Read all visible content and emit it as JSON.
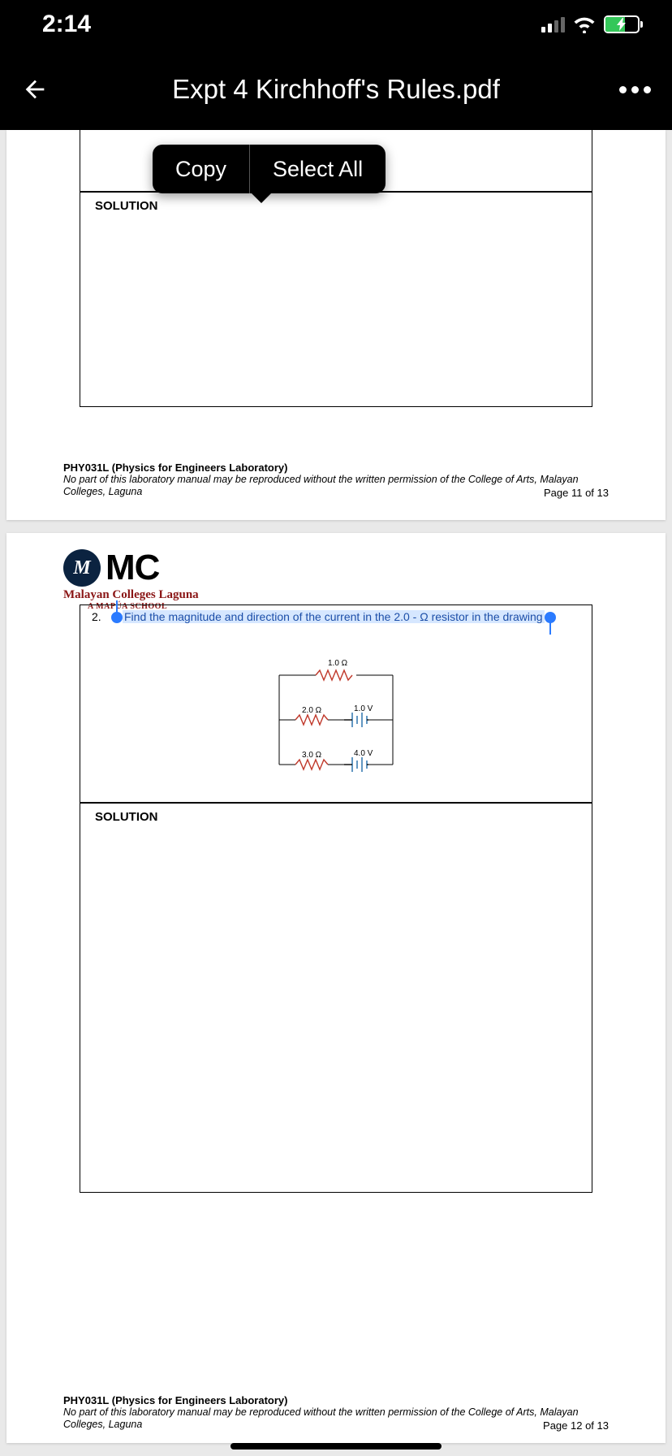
{
  "status": {
    "time": "2:14"
  },
  "nav": {
    "title": "Expt 4 Kirchhoff's Rules.pdf"
  },
  "menu": {
    "copy": "Copy",
    "select_all": "Select All"
  },
  "labels": {
    "solution": "SOLUTION"
  },
  "footer": {
    "course": "PHY031L (Physics for Engineers Laboratory)",
    "disclaimer": "No part of this laboratory manual may be reproduced without the written permission of the College of Arts, Malayan Colleges, Laguna",
    "page11": "Page 11 of 13",
    "page12": "Page 12 of 13"
  },
  "logo": {
    "badge": "M",
    "mc": "MC",
    "sub1": "Malayan Colleges Laguna",
    "sub2": "A MAPÚA SCHOOL"
  },
  "question": {
    "num": "2.",
    "text": "Find the magnitude and direction of the current in the 2.0 - Ω resistor in the drawing"
  },
  "circuit": {
    "r1": "1.0 Ω",
    "r2": "2.0 Ω",
    "r3": "3.0 Ω",
    "v1": "1.0 V",
    "v2": "4.0 V"
  }
}
